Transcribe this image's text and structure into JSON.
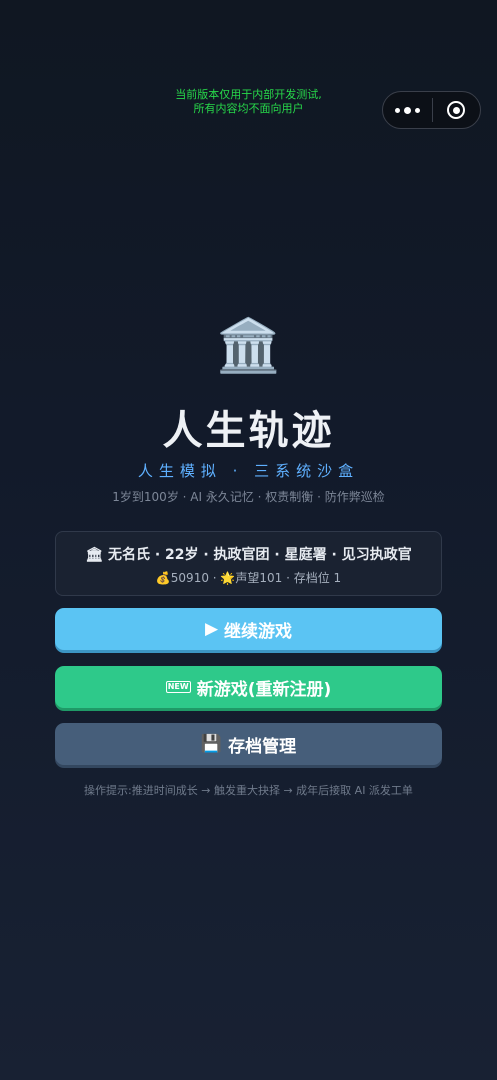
{
  "notice": {
    "line1": "当前版本仅用于内部开发测试,",
    "line2": "所有内容均不面向用户"
  },
  "capsule": {
    "more_icon": "more-dots-icon",
    "close_icon": "target-circle-icon"
  },
  "hero": {
    "emblem": "🏛️",
    "title": "人生轨迹",
    "subtitle": "人生模拟 · 三系统沙盒",
    "tagline": "1岁到100岁 · AI 永久记忆 · 权责制衡 · 防作弊巡检"
  },
  "save_card": {
    "line1": "🏛 无名氏 · 22岁 · 执政官团 · 星庭署 · 见习执政官",
    "line2": "💰50910 · 🌟声望101 · 存档位 1"
  },
  "buttons": {
    "continue_icon": "▶",
    "continue_label": "继续游戏",
    "new_icon": "NEW",
    "new_label": "新游戏(重新注册)",
    "saves_icon": "💾",
    "saves_label": "存档管理"
  },
  "hint": "操作提示:推进时间成长 → 触发重大抉择 → 成年后接取 AI 派发工单"
}
